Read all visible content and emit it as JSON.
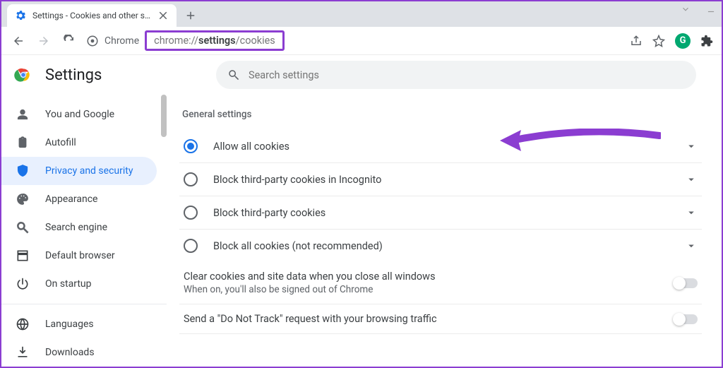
{
  "window": {
    "tab_title": "Settings - Cookies and other site",
    "url_prefix": "chrome://",
    "url_mid": "settings",
    "url_rest": "/cookies",
    "brand": "Chrome"
  },
  "header": {
    "title": "Settings",
    "search_placeholder": "Search settings"
  },
  "sidebar": {
    "items": [
      {
        "label": "You and Google",
        "icon": "person-icon"
      },
      {
        "label": "Autofill",
        "icon": "clipboard-icon"
      },
      {
        "label": "Privacy and security",
        "icon": "shield-icon",
        "active": true
      },
      {
        "label": "Appearance",
        "icon": "palette-icon"
      },
      {
        "label": "Search engine",
        "icon": "magnify-icon"
      },
      {
        "label": "Default browser",
        "icon": "browser-icon"
      },
      {
        "label": "On startup",
        "icon": "power-icon"
      }
    ],
    "items2": [
      {
        "label": "Languages",
        "icon": "globe-icon"
      },
      {
        "label": "Downloads",
        "icon": "download-icon"
      }
    ]
  },
  "content": {
    "section": "General settings",
    "options": [
      {
        "label": "Allow all cookies",
        "selected": true
      },
      {
        "label": "Block third-party cookies in Incognito",
        "selected": false
      },
      {
        "label": "Block third-party cookies",
        "selected": false
      },
      {
        "label": "Block all cookies (not recommended)",
        "selected": false
      }
    ],
    "toggles": [
      {
        "title": "Clear cookies and site data when you close all windows",
        "sub": "When on, you'll also be signed out of Chrome",
        "on": false
      },
      {
        "title": "Send a \"Do Not Track\" request with your browsing traffic",
        "sub": "",
        "on": false
      }
    ]
  }
}
